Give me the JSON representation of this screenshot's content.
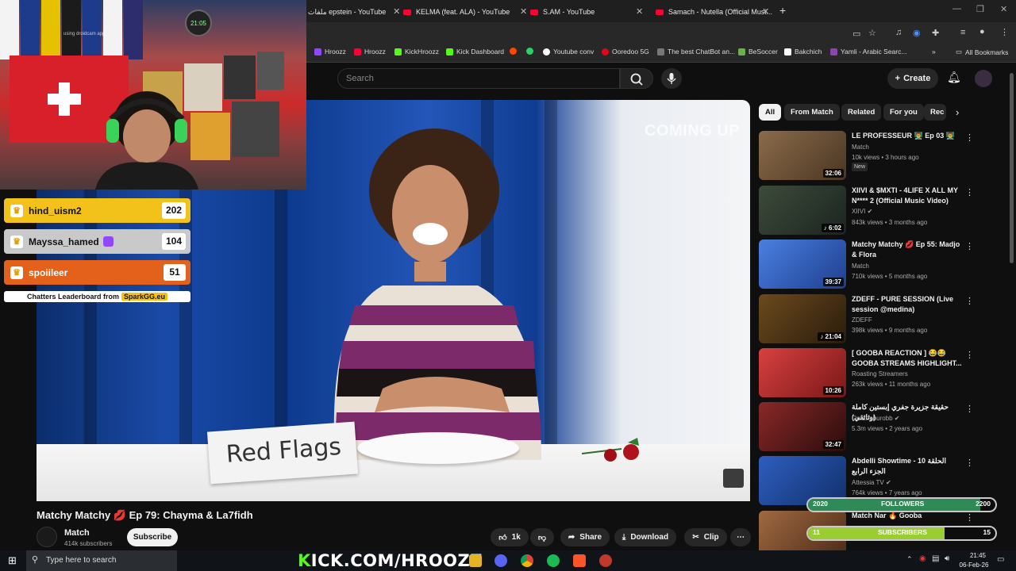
{
  "browser": {
    "tabs": [
      {
        "label": "ملفات epstein - YouTube"
      },
      {
        "label": "KELMA (feat. ALA) - YouTube"
      },
      {
        "label": "S.AM - YouTube"
      },
      {
        "label": "Samach - Nutella (Official Musi..."
      }
    ],
    "bookmarks": [
      {
        "label": "Hroozz",
        "color": "#9147ff"
      },
      {
        "label": "Hroozz",
        "color": "#ff0033"
      },
      {
        "label": "KickHroozz",
        "color": "#53fc18"
      },
      {
        "label": "Kick Dashboard",
        "color": "#53fc18"
      },
      {
        "label": "",
        "color": "#ff4500"
      },
      {
        "label": "",
        "color": "#25d366"
      },
      {
        "label": "Youtube conv",
        "color": "#ffffff"
      },
      {
        "label": "Ooredoo 5G",
        "color": "#e30613"
      },
      {
        "label": "The best ChatBot an...",
        "color": "#777777"
      },
      {
        "label": "BeSoccer",
        "color": "#6ab04c"
      },
      {
        "label": "Bakchich",
        "color": "#ffffff"
      },
      {
        "label": "Yamli - Arabic Searc...",
        "color": "#8e44ad"
      }
    ],
    "all_bookmarks": "All Bookmarks"
  },
  "youtube": {
    "search_placeholder": "Search",
    "create_label": "Create"
  },
  "video": {
    "overlay_text": "COMING UP",
    "sign_text": "Red Flags",
    "title": "Matchy Matchy 💋 Ep 79: Chayma & La7fidh",
    "channel": "Match",
    "subscribers": "414k subscribers",
    "subscribe_label": "Subscribe",
    "likes": "1k",
    "share_label": "Share",
    "download_label": "Download",
    "clip_label": "Clip"
  },
  "webcam": {
    "caption": "using droidcam app",
    "clock": "21:05"
  },
  "leaderboard": {
    "entries": [
      {
        "name": "hind_uism2",
        "score": "202",
        "color": "#f2c21b"
      },
      {
        "name": "Mayssa_hamed",
        "score": "104",
        "color": "#c9c9c9"
      },
      {
        "name": "spoiileer",
        "score": "51",
        "color": "#e4611c"
      }
    ],
    "footer": "Chatters Leaderboard from",
    "footer_brand": "SparkGG.eu"
  },
  "sidebar": {
    "chips": [
      {
        "label": "All",
        "active": true
      },
      {
        "label": "From Match",
        "active": false
      },
      {
        "label": "Related",
        "active": false
      },
      {
        "label": "For you",
        "active": false
      },
      {
        "label": "Rec",
        "active": false
      }
    ],
    "recommendations": [
      {
        "title": "LE PROFESSEUR 👨‍🏫 Ep 03 👨‍🏫",
        "channel": "Match",
        "meta": "10k views • 3 hours ago",
        "duration": "32:06",
        "badge": "New",
        "color": "#7a6248"
      },
      {
        "title": "XIIVI & $MXTI - 4LIFE X ALL MY N**** 2 (Official Music Video)",
        "channel": "XIIVI ✔",
        "meta": "843k views • 3 months ago",
        "duration": "♪ 6:02",
        "badge": "",
        "color": "#2c3b2e"
      },
      {
        "title": "Matchy Matchy 💋 Ep 55: Madjo & Flora",
        "channel": "Match",
        "meta": "710k views • 5 months ago",
        "duration": "39:37",
        "badge": "",
        "color": "#3e6fd0"
      },
      {
        "title": "ZDEFF - PURE SESSION (Live session @medina)",
        "channel": "ZDEFF",
        "meta": "398k views • 9 months ago",
        "duration": "♪ 21:04",
        "badge": "",
        "color": "#3b2a14"
      },
      {
        "title": "[ GOOBA REACTION ] 😂😂 GOOBA STREAMS HIGHLIGHT...",
        "channel": "Roasting Streamers",
        "meta": "263k views • 11 months ago",
        "duration": "10:26",
        "badge": "",
        "color": "#b52a2a"
      },
      {
        "title": "حقيقة جزيرة جفري إبستين كاملة (وثائقي)",
        "channel": "Omar aburobb ✔",
        "meta": "5.3m views • 2 years ago",
        "duration": "32:47",
        "badge": "",
        "color": "#6b2020"
      },
      {
        "title": "Abdelli Showtime - الحلقة 10 الجزء الرابع",
        "channel": "Attessia TV ✔",
        "meta": "764k views • 7 years ago",
        "duration": "",
        "badge": "",
        "color": "#2650a8"
      },
      {
        "title": "Match Nar 🔥 Gooba",
        "channel": "",
        "meta": "",
        "duration": "",
        "badge": "",
        "color": "#8a5a3a"
      }
    ]
  },
  "goals": {
    "followers": {
      "left": "2020",
      "label": "FOLLOWERS",
      "right": "2200",
      "progress": 0.92
    },
    "subscribers": {
      "left": "11",
      "label": "SUBSCRIBERS",
      "right": "15",
      "progress": 0.73
    }
  },
  "taskbar": {
    "search_placeholder": "Type here to search",
    "kick_brand": "K",
    "kick_rest": "ICK.COM/HROOZZ",
    "time": "21:45",
    "date": "06-Feb-26"
  }
}
